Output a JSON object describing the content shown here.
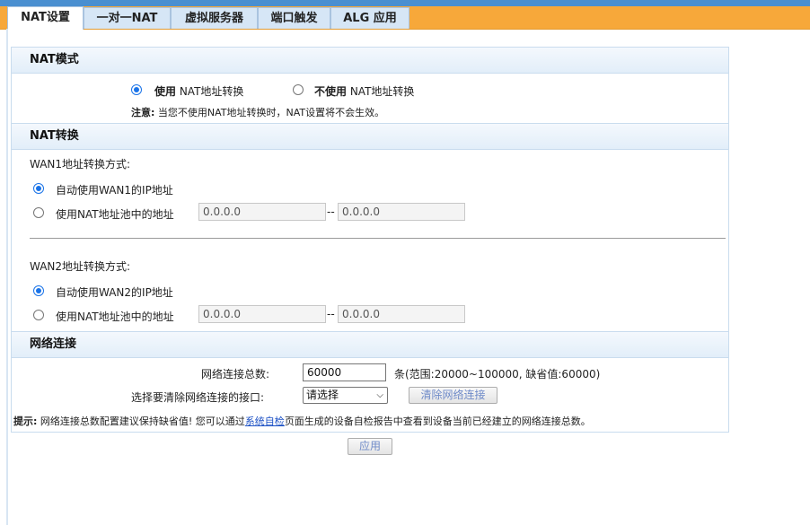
{
  "tabs": [
    {
      "label": "NAT设置"
    },
    {
      "label": "一对一NAT"
    },
    {
      "label": "虚拟服务器"
    },
    {
      "label": "端口触发"
    },
    {
      "label": "ALG 应用"
    }
  ],
  "nat_mode": {
    "title": "NAT模式",
    "option_use_bold": "使用",
    "option_use_rest": " NAT地址转换",
    "option_nouse_bold": "不使用",
    "option_nouse_rest": " NAT地址转换",
    "note_label": "注意:",
    "note_text": " 当您不使用NAT地址转换时，NAT设置将不会生效。",
    "selected": "use"
  },
  "nat_trans": {
    "title": "NAT转换",
    "wan1": {
      "heading": "WAN1地址转换方式:",
      "option_auto": "自动使用WAN1的IP地址",
      "option_pool": "使用NAT地址池中的地址",
      "pool_start": "0.0.0.0",
      "pool_end": "0.0.0.0",
      "separator": "--",
      "selected": "auto"
    },
    "wan2": {
      "heading": "WAN2地址转换方式:",
      "option_auto": "自动使用WAN2的IP地址",
      "option_pool": "使用NAT地址池中的地址",
      "pool_start": "0.0.0.0",
      "pool_end": "0.0.0.0",
      "separator": "--",
      "selected": "auto"
    }
  },
  "network_conn": {
    "title": "网络连接",
    "total_label": "网络连接总数:",
    "total_value": "60000",
    "total_hint": "条(范围:20000~100000, 缺省值:60000)",
    "clear_label": "选择要清除网络连接的接口:",
    "clear_select": "请选择",
    "clear_button": "清除网络连接",
    "tip_label": "提示:",
    "tip_text_before": " 网络连接总数配置建议保持缺省值! 您可以通过",
    "tip_link": "系统自检",
    "tip_text_after": "页面生成的设备自检报告中查看到设备当前已经建立的网络连接总数。"
  },
  "apply_button": "应用",
  "colors": {
    "tab_bar": "#f7a83a",
    "top_line": "#4a8fd0",
    "tab_bg": "#d6e6f6",
    "radio_accent": "#1a73e8"
  }
}
